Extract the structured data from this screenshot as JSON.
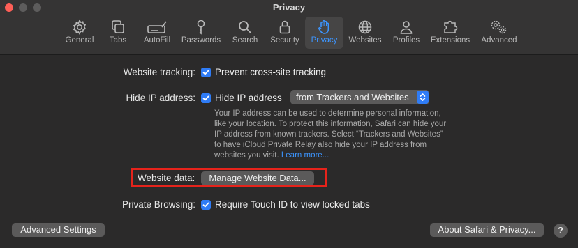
{
  "window": {
    "title": "Privacy"
  },
  "toolbar": {
    "tabs": [
      {
        "label": "General",
        "icon": "gear-icon"
      },
      {
        "label": "Tabs",
        "icon": "tabs-icon"
      },
      {
        "label": "AutoFill",
        "icon": "autofill-icon"
      },
      {
        "label": "Passwords",
        "icon": "key-icon"
      },
      {
        "label": "Search",
        "icon": "search-icon"
      },
      {
        "label": "Security",
        "icon": "lock-icon"
      },
      {
        "label": "Privacy",
        "icon": "hand-icon",
        "active": true
      },
      {
        "label": "Websites",
        "icon": "globe-icon"
      },
      {
        "label": "Profiles",
        "icon": "person-icon"
      },
      {
        "label": "Extensions",
        "icon": "puzzle-icon"
      },
      {
        "label": "Advanced",
        "icon": "gears-icon"
      }
    ]
  },
  "settings": {
    "tracking": {
      "label": "Website tracking:",
      "option": "Prevent cross-site tracking",
      "checked": true
    },
    "hide_ip": {
      "label": "Hide IP address:",
      "option": "Hide IP address",
      "checked": true,
      "popup_value": "from Trackers and Websites",
      "note_lines": [
        "Your IP address can be used to determine personal information,",
        "like your location. To protect this information, Safari can hide your",
        "IP address from known trackers. Select “Trackers and Websites”",
        "to have iCloud Private Relay also hide your IP address from",
        "websites you visit."
      ],
      "learn_more": "Learn more..."
    },
    "website_data": {
      "label": "Website data:",
      "button": "Manage Website Data..."
    },
    "private_browsing": {
      "label": "Private Browsing:",
      "option": "Require Touch ID to view locked tabs",
      "checked": true
    }
  },
  "footer": {
    "advanced_button": "Advanced Settings",
    "about_button": "About Safari & Privacy...",
    "help_button": "?"
  },
  "colors": {
    "accent": "#2f7cf6",
    "link": "#3c95ff",
    "highlight_box": "#e6231b",
    "close": "#fe5f57"
  }
}
